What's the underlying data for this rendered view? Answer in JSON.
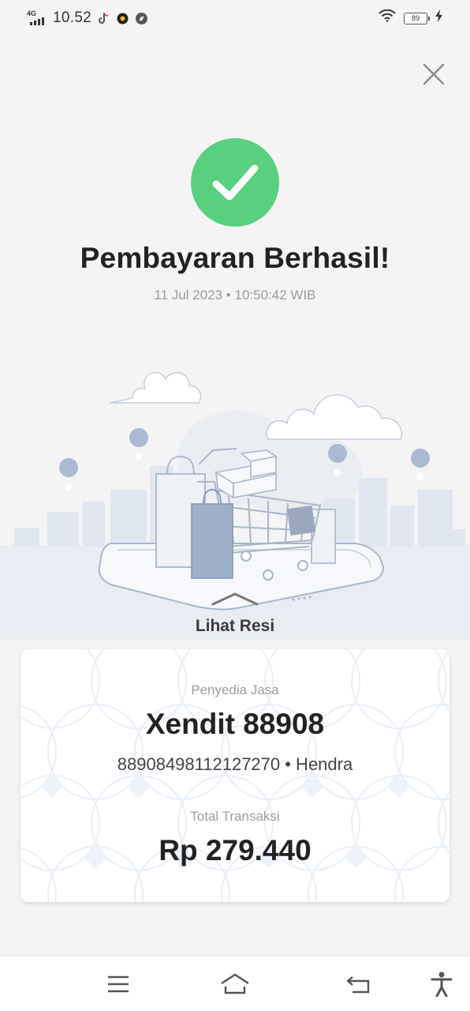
{
  "status_bar": {
    "network": "4G",
    "time": "10.52",
    "battery": "89"
  },
  "page": {
    "title": "Pembayaran Berhasil!",
    "timestamp": "11 Jul 2023 • 10:50:42 WIB",
    "receipt_link": "Lihat Resi"
  },
  "card": {
    "provider_label": "Penyedia Jasa",
    "provider_name": "Xendit 88908",
    "account_line": "889084981121272​70 • Hendra",
    "total_label": "Total Transaksi",
    "total_amount": "Rp 279.440"
  },
  "colors": {
    "success": "#58d07d",
    "background": "#f4f4f4",
    "illustration": "#9fb0ca"
  },
  "icons": [
    "close-icon",
    "checkmark-icon",
    "chevron-up-icon",
    "menu-icon",
    "home-icon",
    "back-icon",
    "accessibility-icon",
    "wifi-icon",
    "battery-icon",
    "tiktok-icon"
  ]
}
